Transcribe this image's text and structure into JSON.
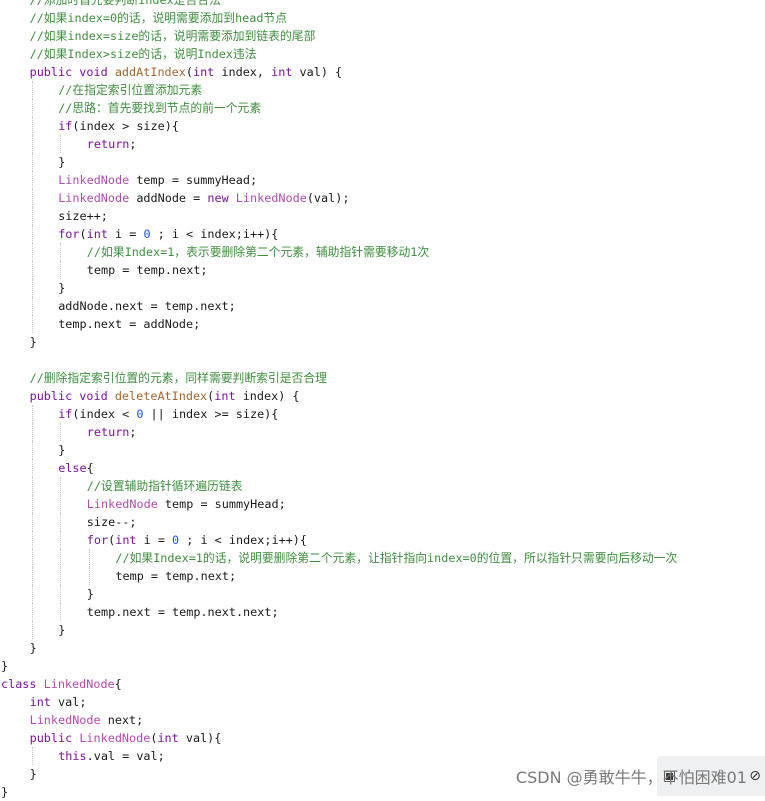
{
  "code_lines": [
    {
      "indent": 1,
      "tokens": [
        {
          "c": "cm",
          "t": "//添加时首先要判断index是否合法"
        }
      ]
    },
    {
      "indent": 1,
      "tokens": [
        {
          "c": "cm",
          "t": "//如果index=0的话，说明需要添加到head节点"
        }
      ]
    },
    {
      "indent": 1,
      "tokens": [
        {
          "c": "cm",
          "t": "//如果index=size的话，说明需要添加到链表的尾部"
        }
      ]
    },
    {
      "indent": 1,
      "tokens": [
        {
          "c": "cm",
          "t": "//如果Index>size的话，说明Index违法"
        }
      ]
    },
    {
      "indent": 1,
      "tokens": [
        {
          "c": "kw",
          "t": "public void "
        },
        {
          "c": "fn",
          "t": "addAtIndex"
        },
        {
          "c": "pl",
          "t": "("
        },
        {
          "c": "kw",
          "t": "int"
        },
        {
          "c": "pl",
          "t": " index, "
        },
        {
          "c": "kw",
          "t": "int"
        },
        {
          "c": "pl",
          "t": " val) {"
        }
      ]
    },
    {
      "indent": 2,
      "tokens": [
        {
          "c": "cm",
          "t": "//在指定索引位置添加元素"
        }
      ]
    },
    {
      "indent": 2,
      "tokens": [
        {
          "c": "cm",
          "t": "//思路：首先要找到节点的前一个元素"
        }
      ]
    },
    {
      "indent": 2,
      "tokens": [
        {
          "c": "kw",
          "t": "if"
        },
        {
          "c": "pl",
          "t": "(index > size){"
        }
      ]
    },
    {
      "indent": 3,
      "tokens": [
        {
          "c": "kw",
          "t": "return"
        },
        {
          "c": "pl",
          "t": ";"
        }
      ]
    },
    {
      "indent": 2,
      "tokens": [
        {
          "c": "pl",
          "t": "}"
        }
      ]
    },
    {
      "indent": 2,
      "tokens": [
        {
          "c": "ty",
          "t": "LinkedNode"
        },
        {
          "c": "pl",
          "t": " temp = summyHead;"
        }
      ]
    },
    {
      "indent": 2,
      "tokens": [
        {
          "c": "ty",
          "t": "LinkedNode"
        },
        {
          "c": "pl",
          "t": " addNode = "
        },
        {
          "c": "kw",
          "t": "new "
        },
        {
          "c": "ty",
          "t": "LinkedNode"
        },
        {
          "c": "pl",
          "t": "(val);"
        }
      ]
    },
    {
      "indent": 2,
      "tokens": [
        {
          "c": "pl",
          "t": "size++;"
        }
      ]
    },
    {
      "indent": 2,
      "tokens": [
        {
          "c": "kw",
          "t": "for"
        },
        {
          "c": "pl",
          "t": "("
        },
        {
          "c": "kw",
          "t": "int"
        },
        {
          "c": "pl",
          "t": " i = "
        },
        {
          "c": "num",
          "t": "0"
        },
        {
          "c": "pl",
          "t": " ; i < index;i++){"
        }
      ]
    },
    {
      "indent": 3,
      "tokens": [
        {
          "c": "cm",
          "t": "//如果Index=1，表示要删除第二个元素，辅助指针需要移动1次"
        }
      ]
    },
    {
      "indent": 3,
      "tokens": [
        {
          "c": "pl",
          "t": "temp = temp.next;"
        }
      ]
    },
    {
      "indent": 2,
      "tokens": [
        {
          "c": "pl",
          "t": "}"
        }
      ]
    },
    {
      "indent": 2,
      "tokens": [
        {
          "c": "pl",
          "t": "addNode.next = temp.next;"
        }
      ]
    },
    {
      "indent": 2,
      "tokens": [
        {
          "c": "pl",
          "t": "temp.next = addNode;"
        }
      ]
    },
    {
      "indent": 1,
      "tokens": [
        {
          "c": "pl",
          "t": "}"
        }
      ]
    },
    {
      "indent": 0,
      "tokens": []
    },
    {
      "indent": 1,
      "tokens": [
        {
          "c": "cm",
          "t": "//删除指定索引位置的元素，同样需要判断索引是否合理"
        }
      ]
    },
    {
      "indent": 1,
      "tokens": [
        {
          "c": "kw",
          "t": "public void "
        },
        {
          "c": "fn",
          "t": "deleteAtIndex"
        },
        {
          "c": "pl",
          "t": "("
        },
        {
          "c": "kw",
          "t": "int"
        },
        {
          "c": "pl",
          "t": " index) {"
        }
      ]
    },
    {
      "indent": 2,
      "tokens": [
        {
          "c": "kw",
          "t": "if"
        },
        {
          "c": "pl",
          "t": "(index < "
        },
        {
          "c": "num",
          "t": "0"
        },
        {
          "c": "pl",
          "t": " || index >= size){"
        }
      ]
    },
    {
      "indent": 3,
      "tokens": [
        {
          "c": "kw",
          "t": "return"
        },
        {
          "c": "pl",
          "t": ";"
        }
      ]
    },
    {
      "indent": 2,
      "tokens": [
        {
          "c": "pl",
          "t": "}"
        }
      ]
    },
    {
      "indent": 2,
      "tokens": [
        {
          "c": "kw",
          "t": "else"
        },
        {
          "c": "pl",
          "t": "{"
        }
      ]
    },
    {
      "indent": 3,
      "tokens": [
        {
          "c": "cm",
          "t": "//设置辅助指针循环遍历链表"
        }
      ]
    },
    {
      "indent": 3,
      "tokens": [
        {
          "c": "ty",
          "t": "LinkedNode"
        },
        {
          "c": "pl",
          "t": " temp = summyHead;"
        }
      ]
    },
    {
      "indent": 3,
      "tokens": [
        {
          "c": "pl",
          "t": "size--;"
        }
      ]
    },
    {
      "indent": 3,
      "tokens": [
        {
          "c": "kw",
          "t": "for"
        },
        {
          "c": "pl",
          "t": "("
        },
        {
          "c": "kw",
          "t": "int"
        },
        {
          "c": "pl",
          "t": " i = "
        },
        {
          "c": "num",
          "t": "0"
        },
        {
          "c": "pl",
          "t": " ; i < index;i++){"
        }
      ]
    },
    {
      "indent": 4,
      "tokens": [
        {
          "c": "cm",
          "t": "//如果Index=1的话，说明要删除第二个元素，让指针指向index=0的位置，所以指针只需要向后移动一次"
        }
      ]
    },
    {
      "indent": 4,
      "tokens": [
        {
          "c": "pl",
          "t": "temp = temp.next;"
        }
      ]
    },
    {
      "indent": 3,
      "tokens": [
        {
          "c": "pl",
          "t": "}"
        }
      ]
    },
    {
      "indent": 3,
      "tokens": [
        {
          "c": "pl",
          "t": "temp.next = temp.next.next;"
        }
      ]
    },
    {
      "indent": 2,
      "tokens": [
        {
          "c": "pl",
          "t": "}"
        }
      ]
    },
    {
      "indent": 1,
      "tokens": [
        {
          "c": "pl",
          "t": "}"
        }
      ]
    },
    {
      "indent": 0,
      "tokens": [
        {
          "c": "pl",
          "t": "}"
        }
      ]
    },
    {
      "indent": 0,
      "tokens": [
        {
          "c": "kw",
          "t": "class "
        },
        {
          "c": "ty",
          "t": "LinkedNode"
        },
        {
          "c": "pl",
          "t": "{"
        }
      ]
    },
    {
      "indent": 1,
      "tokens": [
        {
          "c": "kw",
          "t": "int"
        },
        {
          "c": "pl",
          "t": " val;"
        }
      ]
    },
    {
      "indent": 1,
      "tokens": [
        {
          "c": "ty",
          "t": "LinkedNode"
        },
        {
          "c": "pl",
          "t": " next;"
        }
      ]
    },
    {
      "indent": 1,
      "tokens": [
        {
          "c": "kw",
          "t": "public "
        },
        {
          "c": "ty",
          "t": "LinkedNode"
        },
        {
          "c": "pl",
          "t": "("
        },
        {
          "c": "kw",
          "t": "int"
        },
        {
          "c": "pl",
          "t": " val){"
        }
      ]
    },
    {
      "indent": 2,
      "tokens": [
        {
          "c": "kw",
          "t": "this"
        },
        {
          "c": "pl",
          "t": ".val = val;"
        }
      ]
    },
    {
      "indent": 1,
      "tokens": [
        {
          "c": "pl",
          "t": "}"
        }
      ]
    },
    {
      "indent": 0,
      "tokens": [
        {
          "c": "pl",
          "t": "}"
        }
      ]
    }
  ],
  "colors": {
    "keyword": "#7f0f9f",
    "comment": "#3f8f3f",
    "type": "#b34ab3",
    "method": "#a9652f",
    "number": "#1750eb",
    "text": "#1a1a1a",
    "background": "#ffffff"
  },
  "watermark": {
    "text": "CSDN @勇敢牛牛，不怕困难01",
    "icons": [
      "ruler-icon",
      "close-icon"
    ]
  }
}
